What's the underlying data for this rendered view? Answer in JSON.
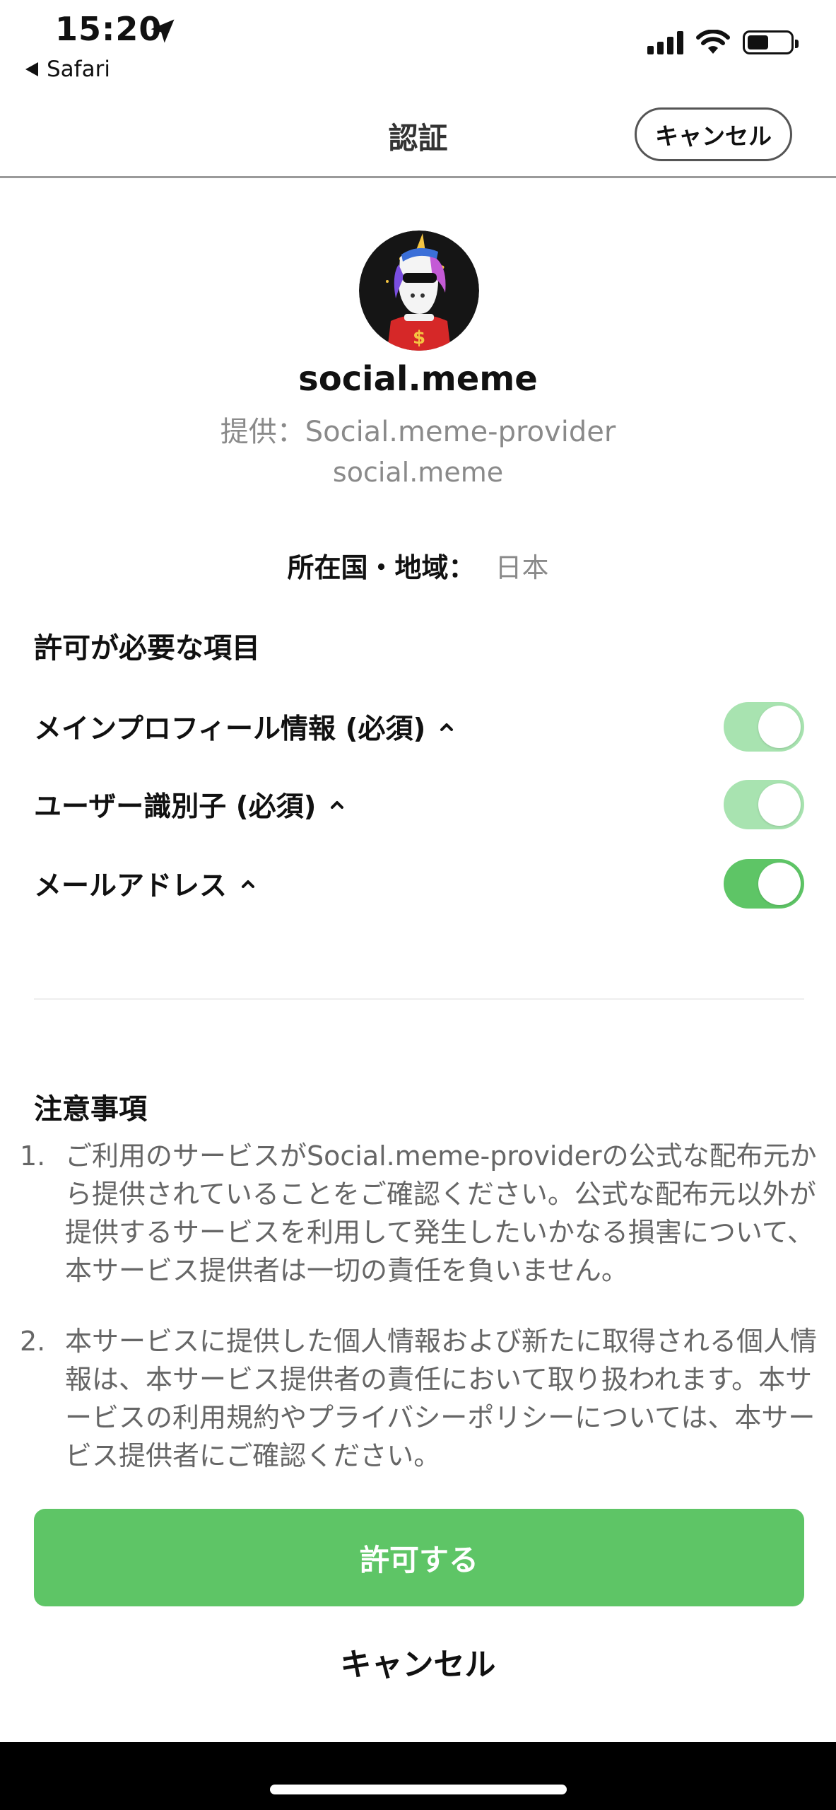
{
  "status_bar": {
    "time": "15:20",
    "back_app": "Safari"
  },
  "nav": {
    "title": "認証",
    "cancel_label": "キャンセル"
  },
  "app": {
    "name": "social.meme",
    "provider": "提供：Social.meme-provider",
    "domain": "social.meme",
    "region_label": "所在国・地域：",
    "region_value": "日本"
  },
  "permissions": {
    "title": "許可が必要な項目",
    "items": [
      {
        "label": "メインプロフィール情報 (必須)",
        "enabled": true,
        "locked": true
      },
      {
        "label": "ユーザー識別子 (必須)",
        "enabled": true,
        "locked": true
      },
      {
        "label": "メールアドレス",
        "enabled": true,
        "locked": false
      }
    ]
  },
  "notes": {
    "title": "注意事項",
    "items": [
      {
        "num": "1.",
        "text": "ご利用のサービスがSocial.meme-providerの公式な配布元から提供されていることをご確認ください。公式な配布元以外が提供するサービスを利用して発生したいかなる損害について、本サービス提供者は一切の責任を負いません。"
      },
      {
        "num": "2.",
        "text": "本サービスに提供した個人情報および新たに取得される個人情報は、本サービス提供者の責任において取り扱われます。本サービスの利用規約やプライバシーポリシーについては、本サービス提供者にご確認ください。"
      }
    ]
  },
  "actions": {
    "allow_label": "許可する",
    "cancel_label": "キャンセル"
  },
  "colors": {
    "accent": "#5ec566",
    "toggle_on": "#5ec566",
    "toggle_disabled": "#a8e3b0"
  }
}
